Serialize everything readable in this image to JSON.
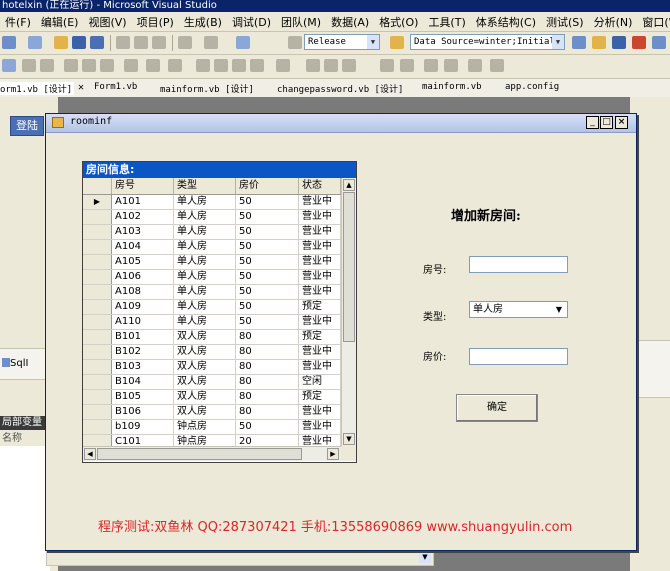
{
  "vs": {
    "title": "hotelxin (正在运行) - Microsoft Visual Studio",
    "menu": [
      "件(F)",
      "编辑(E)",
      "视图(V)",
      "项目(P)",
      "生成(B)",
      "调试(D)",
      "团队(M)",
      "数据(A)",
      "格式(O)",
      "工具(T)",
      "体系结构(C)",
      "测试(S)",
      "分析(N)",
      "窗口(W)"
    ],
    "config_combo": "Release",
    "datasource_combo": "Data Source=winter;Initial C",
    "doc_tabs": [
      "orm1.vb [设计]",
      "Form1.vb",
      "mainform.vb [设计]",
      "changepassword.vb [设计]",
      "mainform.vb",
      "app.config"
    ],
    "login_tab": "登陆",
    "sql_label": "SqlI",
    "vars_header": "局部变量",
    "vars_col_name": "名称"
  },
  "form": {
    "title": "roominf",
    "min_label": "_",
    "max_label": "□",
    "close_label": "×",
    "grid": {
      "caption": "房间信息:",
      "columns": [
        "房号",
        "类型",
        "房价",
        "状态"
      ],
      "selected_row": 0,
      "rows": [
        [
          "A101",
          "单人房",
          "50",
          "营业中"
        ],
        [
          "A102",
          "单人房",
          "50",
          "营业中"
        ],
        [
          "A103",
          "单人房",
          "50",
          "营业中"
        ],
        [
          "A104",
          "单人房",
          "50",
          "营业中"
        ],
        [
          "A105",
          "单人房",
          "50",
          "营业中"
        ],
        [
          "A106",
          "单人房",
          "50",
          "营业中"
        ],
        [
          "A108",
          "单人房",
          "50",
          "营业中"
        ],
        [
          "A109",
          "单人房",
          "50",
          "预定"
        ],
        [
          "A110",
          "单人房",
          "50",
          "营业中"
        ],
        [
          "B101",
          "双人房",
          "80",
          "预定"
        ],
        [
          "B102",
          "双人房",
          "80",
          "营业中"
        ],
        [
          "B103",
          "双人房",
          "80",
          "营业中"
        ],
        [
          "B104",
          "双人房",
          "80",
          "空闲"
        ],
        [
          "B105",
          "双人房",
          "80",
          "预定"
        ],
        [
          "B106",
          "双人房",
          "80",
          "营业中"
        ],
        [
          "b109",
          "钟点房",
          "50",
          "营业中"
        ],
        [
          "C101",
          "钟点房",
          "20",
          "营业中"
        ]
      ]
    },
    "add_heading": "增加新房间:",
    "room_no_label": "房号:",
    "room_no_value": "",
    "type_label": "类型:",
    "type_value": "单人房",
    "price_label": "房价:",
    "price_value": "",
    "ok_label": "确定",
    "footer": "程序测试:双鱼林 QQ:287307421 手机:13558690869 www.shuangyulin.com"
  },
  "colors": {
    "grid_caption_bg": "#0b55c4",
    "footer_text": "#d9262a",
    "vs_title_bg": "#0a246a"
  }
}
